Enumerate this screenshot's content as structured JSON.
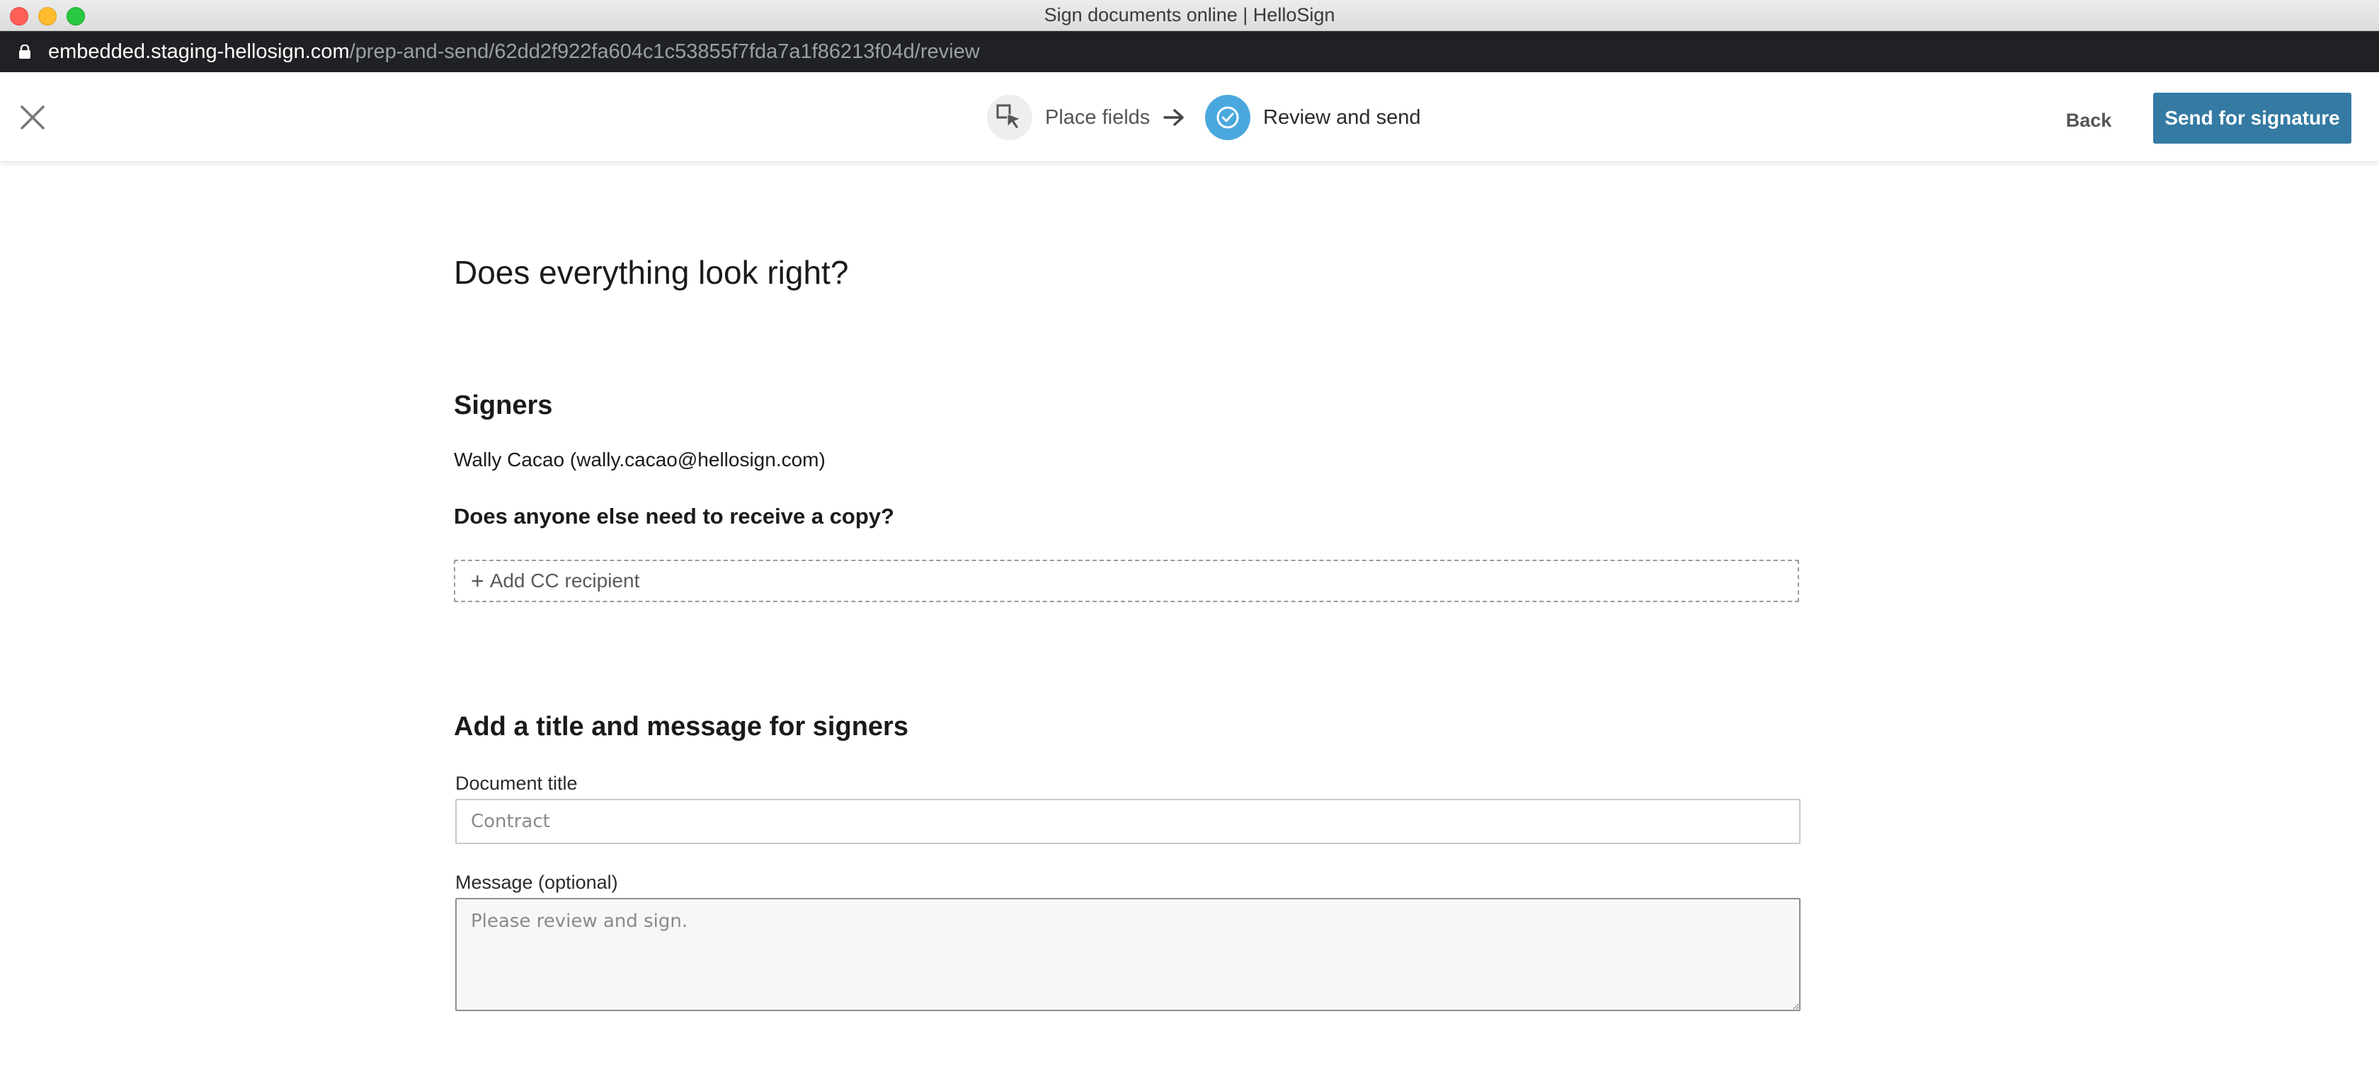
{
  "window": {
    "title": "Sign documents online | HelloSign"
  },
  "browser": {
    "url_host": "embedded.staging-hellosign.com",
    "url_path": "/prep-and-send/62dd2f922fa604c1c53855f7fda7a1f86213f04d/review"
  },
  "header": {
    "steps": [
      {
        "label": "Place fields",
        "icon": "place-fields-icon",
        "active": false
      },
      {
        "label": "Review and send",
        "icon": "check-circle-icon",
        "active": true
      }
    ],
    "back_label": "Back",
    "send_label": "Send for signature",
    "accent_color": "#347aa3",
    "active_step_color": "#4aa8de"
  },
  "main": {
    "title": "Does everything look right?",
    "signers": {
      "heading": "Signers",
      "entries": [
        "Wally Cacao (wally.cacao@hellosign.com)"
      ]
    },
    "cc": {
      "question": "Does anyone else need to receive a copy?",
      "add_label": "Add CC recipient"
    },
    "message_section": {
      "heading": "Add a title and message for signers",
      "doc_title_label": "Document title",
      "doc_title_value": "",
      "doc_title_placeholder": "Contract",
      "message_label": "Message (optional)",
      "message_value": "",
      "message_placeholder": "Please review and sign."
    }
  }
}
